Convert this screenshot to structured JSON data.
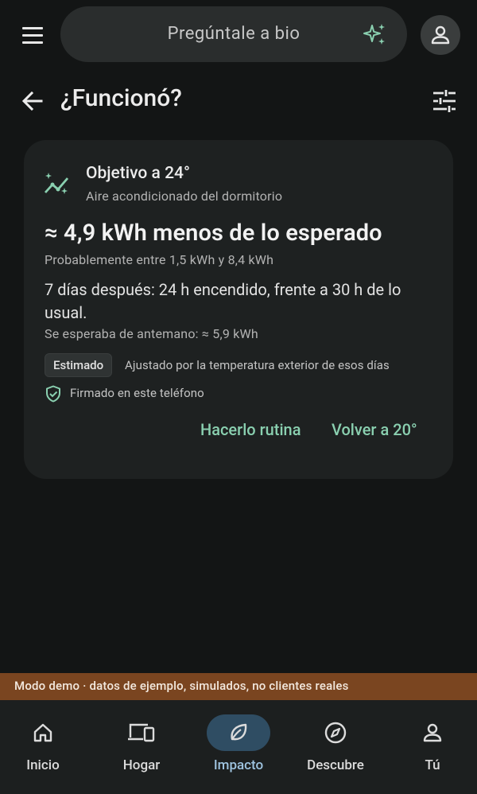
{
  "search": {
    "placeholder": "Pregúntale a bio"
  },
  "header": {
    "title": "¿Funcionó?"
  },
  "card": {
    "title": "Objetivo a 24°",
    "subtitle": "Aire acondicionado del dormitorio",
    "headline": "≈ 4,9 kWh menos de lo esperado",
    "range": "Probablemente entre 1,5 kWh y 8,4 kWh",
    "detail": "7 días después: 24 h encendido, frente a 30 h de lo usual.",
    "expected": "Se esperaba de antemano: ≈ 5,9 kWh",
    "chip_label": "Estimado",
    "chip_note": "Ajustado por la temperatura exterior de esos días",
    "signed": "Firmado en este teléfono",
    "actions": {
      "routine": "Hacerlo rutina",
      "revert": "Volver a 20°"
    }
  },
  "banner": {
    "text": "Modo demo · datos de ejemplo, simulados, no clientes reales"
  },
  "nav": {
    "items": [
      {
        "label": "Inicio",
        "icon": "home-icon"
      },
      {
        "label": "Hogar",
        "icon": "devices-icon"
      },
      {
        "label": "Impacto",
        "icon": "leaf-icon",
        "active": true
      },
      {
        "label": "Descubre",
        "icon": "compass-icon"
      },
      {
        "label": "Tú",
        "icon": "person-icon"
      }
    ]
  },
  "colors": {
    "background": "#131515",
    "card": "#1e2121",
    "accent": "#8ad0b0",
    "banner": "#7a4520",
    "nav_active": "#2f4d63"
  }
}
